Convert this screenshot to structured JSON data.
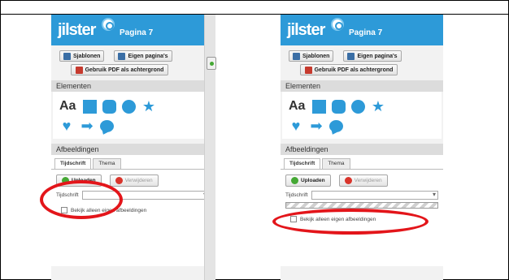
{
  "app": {
    "logo_text": "jilster",
    "page_label": "Pagina 7"
  },
  "toolbar": {
    "templates_label": "Sjablonen",
    "own_pages_label": "Eigen pagina's",
    "pdf_background_label": "Gebruik PDF als achtergrond"
  },
  "elements": {
    "title": "Elementen",
    "text_tool": "Aa",
    "shapes": [
      "square-icon",
      "rounded-square-icon",
      "circle-icon",
      "star-icon",
      "heart-icon",
      "arrow-icon",
      "speech-bubble-icon"
    ]
  },
  "images": {
    "title": "Afbeeldingen",
    "tab_magazine": "Tijdschrift",
    "tab_theme": "Thema",
    "upload_label": "Uploaden",
    "delete_label": "Verwijderen",
    "magazine_label": "Tijdschrift",
    "own_images_label": "Bekijk alleen eigen afbeeldingen"
  },
  "colors": {
    "brand_blue": "#2d9ad8",
    "highlight_red": "#e3151a",
    "upload_green": "#45a834",
    "delete_red": "#d9342b"
  }
}
